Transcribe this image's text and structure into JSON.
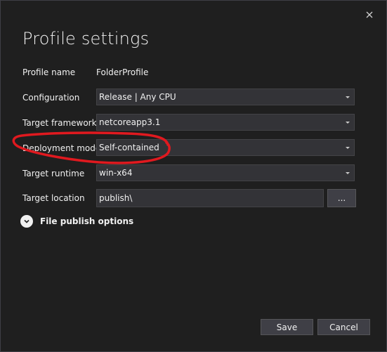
{
  "dialog": {
    "title": "Profile settings",
    "close_icon": "close-icon"
  },
  "fields": {
    "profile_name": {
      "label": "Profile name",
      "value": "FolderProfile"
    },
    "configuration": {
      "label": "Configuration",
      "value": "Release | Any CPU"
    },
    "target_framework": {
      "label": "Target framework",
      "value": "netcoreapp3.1"
    },
    "deployment_mode": {
      "label": "Deployment mode",
      "value": "Self-contained"
    },
    "target_runtime": {
      "label": "Target runtime",
      "value": "win-x64"
    },
    "target_location": {
      "label": "Target location",
      "value": "publish\\",
      "browse_label": "..."
    }
  },
  "expander": {
    "label": "File publish options",
    "icon": "chevron-down-icon"
  },
  "footer": {
    "save_label": "Save",
    "cancel_label": "Cancel"
  },
  "colors": {
    "background": "#1f1f1f",
    "input_background": "#333337",
    "input_border": "#434346",
    "text": "#f1f1f1",
    "annotation": "#e0191f"
  }
}
